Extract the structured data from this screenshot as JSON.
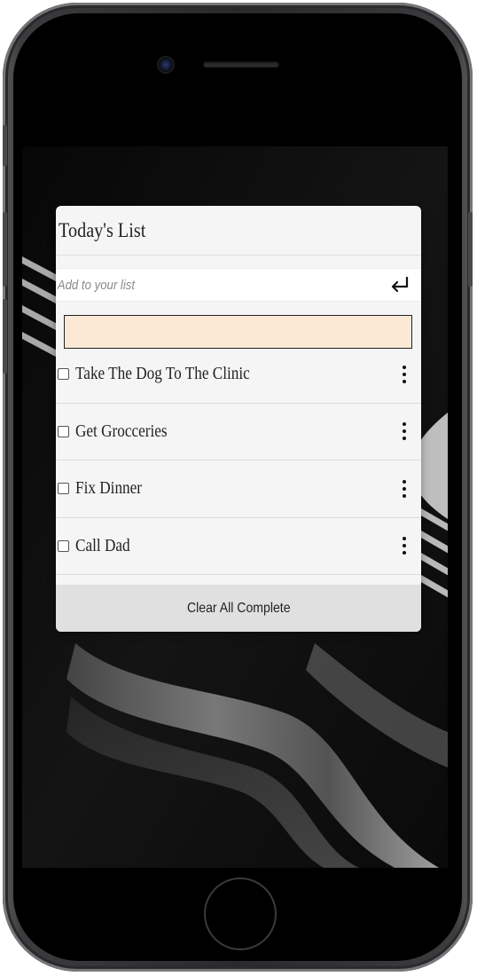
{
  "app": {
    "title": "Today's List",
    "add_placeholder": "Add to your list",
    "enter_icon": "enter-return-icon",
    "more_icon": "kebab-menu-icon"
  },
  "todo_items": [
    {
      "label": "Take The Dog To The Clinic",
      "checked": false
    },
    {
      "label": "Get Grocceries",
      "checked": false
    },
    {
      "label": "Fix Dinner",
      "checked": false
    },
    {
      "label": "Call Dad",
      "checked": false
    }
  ],
  "footer": {
    "clear_label": "Clear All Complete"
  },
  "colors": {
    "card_background": "#f5f5f5",
    "highlight_fill": "#fbe9d6",
    "footer_background": "#e0e0e0",
    "phone_body": "#2a2a2c"
  }
}
